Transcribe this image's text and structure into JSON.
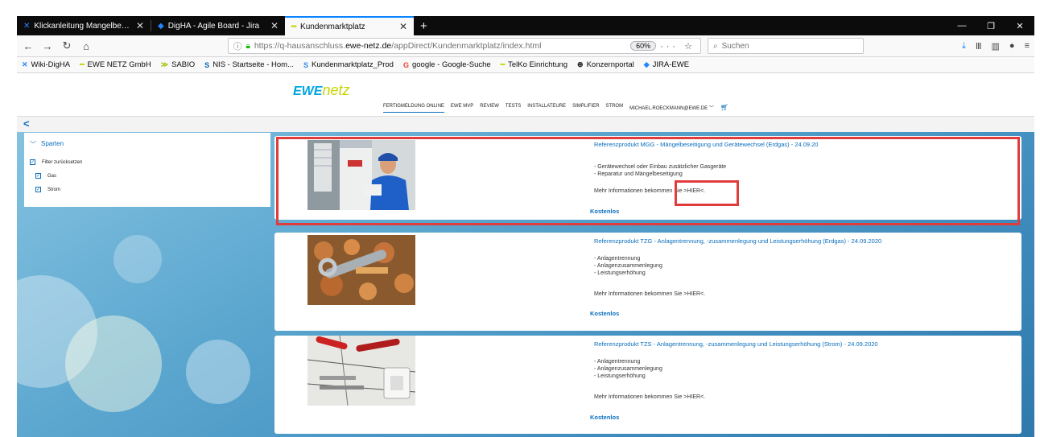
{
  "tabs": [
    {
      "label": "Klickanleitung Mangelbeseitigu",
      "icon": "jira-icon"
    },
    {
      "label": "DigHA - Agile Board - Jira",
      "icon": "jira-icon"
    },
    {
      "label": "Kundenmarktplatz",
      "icon": "ewe-icon",
      "active": true
    }
  ],
  "nav": {
    "url_prefix": "https://q-hausanschluss.",
    "url_domain": "ewe-netz.de",
    "url_path": "/appDirect/Kundenmarktplatz/index.html",
    "zoom": "60%",
    "search_placeholder": "Suchen"
  },
  "bookmarks": [
    "Wiki-DigHA",
    "EWE NETZ GmbH",
    "SABIO",
    "NIS - Startseite - Hom...",
    "Kundenmarktplatz_Prod",
    "google - Google-Suche",
    "TelKo Einrichtung",
    "Konzernportal",
    "JIRA-EWE"
  ],
  "site": {
    "logo_ewe": "EWE",
    "logo_netz": "netz",
    "nav": [
      "FERTIGMELDUNG ONLINE",
      "EWE MVP",
      "REVIEW",
      "TESTS",
      "INSTALLATEURE",
      "SIMPLIFIER",
      "STROM",
      "MICHAEL.ROECKMANN@EWE.DE"
    ],
    "back": "<"
  },
  "filter": {
    "heading": "Sparten",
    "reset": "Filter zurücksetzen",
    "items": [
      "Gas",
      "Strom"
    ]
  },
  "products": [
    {
      "title": "Referenzprodukt MGG - Mängelbeseitigung und Gerätewechsel (Erdgas) - 24.09.20",
      "bullets": [
        "- Gerätewechsel oder Einbau zusätzlicher Gasgeräte",
        "- Reparatur und Mängelbeseitigung"
      ],
      "more": "Mehr Informationen bekommen Sie >HIER<.",
      "price": "Kostenlos"
    },
    {
      "title": "Referenzprodukt TZG - Anlagentrennung, -zusammenlegung und Leistungserhöhung (Erdgas) - 24.09.2020",
      "bullets": [
        "- Anlagentrennung",
        "- Anlagenzusammenlegung",
        "- Leistungserhöhung"
      ],
      "more": "Mehr Informationen bekommen Sie >HIER<.",
      "price": "Kostenlos"
    },
    {
      "title": "Referenzprodukt TZS - Anlagentrennung, -zusammenlegung und Leistungserhöhung (Strom) - 24.09.2020",
      "bullets": [
        "- Anlagentrennung",
        "- Anlagenzusammenlegung",
        "- Leistungserhöhung"
      ],
      "more": "Mehr Informationen bekommen Sie >HIER<.",
      "price": "Kostenlos"
    }
  ],
  "colors": {
    "accent": "#0a6ebd",
    "highlight": "#e03c3c",
    "brand_green": "#c8d400"
  }
}
